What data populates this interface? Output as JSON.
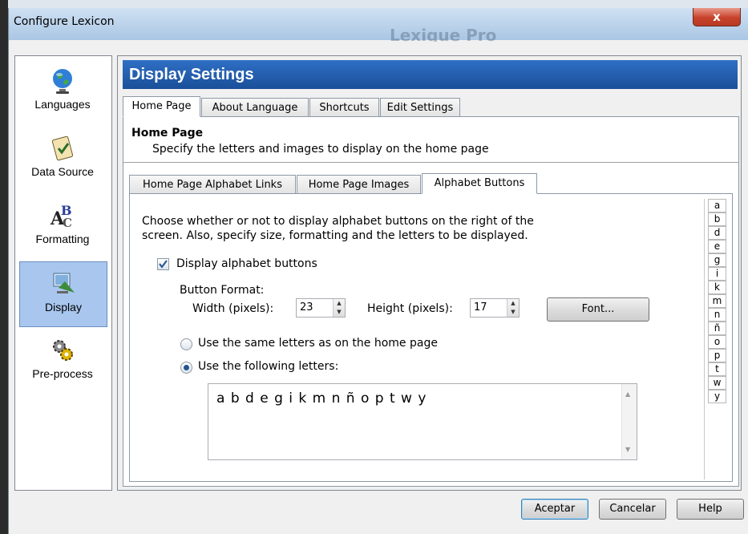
{
  "window": {
    "title": "Configure Lexicon",
    "ghost_title": "Lexique Pro",
    "close_label": "x"
  },
  "sidebar": {
    "items": [
      {
        "label": "Languages",
        "icon": "globe-icon"
      },
      {
        "label": "Data Source",
        "icon": "checklist-icon"
      },
      {
        "label": "Formatting",
        "icon": "abc-icon"
      },
      {
        "label": "Display",
        "icon": "display-icon",
        "selected": true
      },
      {
        "label": "Pre-process",
        "icon": "gears-icon"
      }
    ]
  },
  "header": {
    "title": "Display Settings",
    "color": "#1f5aa8"
  },
  "main_tabs": [
    {
      "label": "Home Page",
      "active": true
    },
    {
      "label": "About Language"
    },
    {
      "label": "Shortcuts"
    },
    {
      "label": "Edit Settings"
    }
  ],
  "home_page": {
    "title": "Home Page",
    "description": "Specify the letters and images to display on the home page"
  },
  "sub_tabs": [
    {
      "label": "Home Page Alphabet Links"
    },
    {
      "label": "Home Page Images"
    },
    {
      "label": "Alphabet Buttons",
      "active": true
    }
  ],
  "alphabet": {
    "intro_line1": "Choose whether or not to display alphabet buttons on the right of the",
    "intro_line2": "screen. Also, specify size, formatting and the letters to be displayed.",
    "display_checkbox_label": "Display alphabet buttons",
    "display_checked": true,
    "button_format_label": "Button Format:",
    "width_label": "Width (pixels):",
    "width_value": "23",
    "height_label": "Height (pixels):",
    "height_value": "17",
    "font_button": "Font...",
    "radio_same": "Use the same letters as on the home page",
    "radio_following": "Use the following letters:",
    "selected_radio": "following",
    "letters_value": "a b d e g i k m n ñ o p t w y"
  },
  "letter_buttons": [
    "a",
    "b",
    "d",
    "e",
    "g",
    "i",
    "k",
    "m",
    "n",
    "ñ",
    "o",
    "p",
    "t",
    "w",
    "y"
  ],
  "footer": {
    "ok": "Aceptar",
    "cancel": "Cancelar",
    "help": "Help"
  }
}
